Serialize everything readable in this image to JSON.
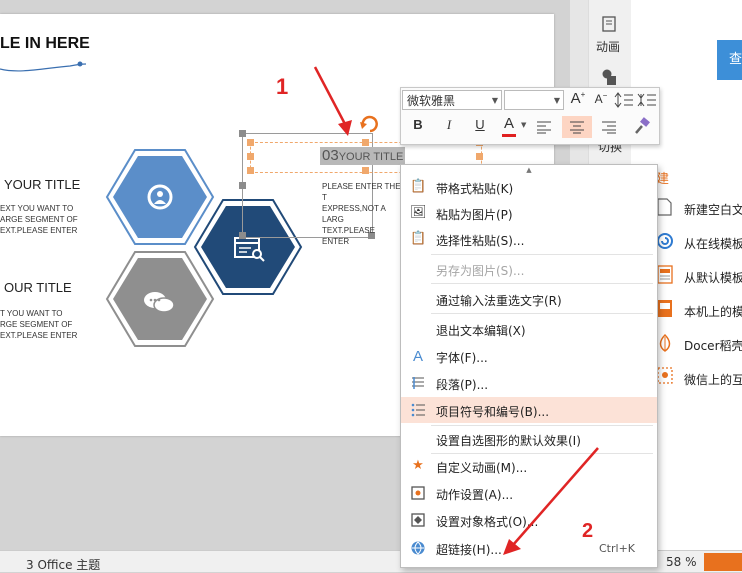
{
  "slide": {
    "title": "LE IN HERE",
    "left_blocks": [
      {
        "title": "YOUR TITLE",
        "body": "EXT YOU WANT TO\nARGE SEGMENT OF\nEXT.PLEASE ENTER"
      },
      {
        "title": "OUR TITLE",
        "body": "T YOU WANT TO\nRGE SEGMENT OF\nEXT.PLEASE ENTER"
      }
    ],
    "selected_text": {
      "number": "03",
      "title": "YOUR TITLE"
    },
    "body_text": "PLEASE ENTER THE T\nEXPRESS,NOT A LARG\nTEXT.PLEASE ENTER",
    "annotation_1": "1",
    "annotation_2": "2"
  },
  "mini_toolbar": {
    "font_name": "微软雅黑",
    "font_size": "",
    "grow_font": "A",
    "shrink_font": "A",
    "bold": "B",
    "italic": "I",
    "underline": "U",
    "font_color": "A",
    "colors": {
      "font_color_bar": "#e02020",
      "active_bg": "#fdd5c3"
    }
  },
  "context_menu": {
    "items": [
      {
        "label": "带格式粘贴(K)",
        "icon": "paste-format-icon"
      },
      {
        "label": "粘贴为图片(P)",
        "icon": "paste-image-icon"
      },
      {
        "label": "选择性粘贴(S)...",
        "icon": "paste-special-icon"
      },
      {
        "label": "另存为图片(S)...",
        "disabled": true
      },
      {
        "label": "通过输入法重选文字(R)"
      },
      {
        "label": "退出文本编辑(X)"
      },
      {
        "label": "字体(F)...",
        "icon": "font-icon"
      },
      {
        "label": "段落(P)...",
        "icon": "paragraph-icon"
      },
      {
        "label": "项目符号和编号(B)...",
        "icon": "bullets-icon",
        "highlighted": true
      },
      {
        "label": "设置自选图形的默认效果(I)"
      },
      {
        "label": "自定义动画(M)...",
        "icon": "star-animation-icon"
      },
      {
        "label": "动作设置(A)...",
        "icon": "action-icon"
      },
      {
        "label": "设置对象格式(O)...",
        "icon": "format-object-icon"
      },
      {
        "label": "超链接(H)...",
        "icon": "hyperlink-icon",
        "shortcut": "Ctrl+K"
      }
    ]
  },
  "right_panel": {
    "tool_labels": [
      "动画",
      "切换"
    ],
    "section_label": "建",
    "top_button": "查",
    "items": [
      "新建空白文",
      "从在线模板",
      "从默认模板",
      "本机上的模",
      "Docer稻壳",
      "微信上的互"
    ]
  },
  "status_bar": {
    "theme": "3 Office 主题",
    "zoom": "58 %"
  },
  "colors": {
    "hex_light": "#5b8ec9",
    "hex_dark": "#214a78",
    "hex_gray": "#8f8f8f",
    "accent_orange": "#e8711e",
    "annotation_red": "#e02525"
  }
}
